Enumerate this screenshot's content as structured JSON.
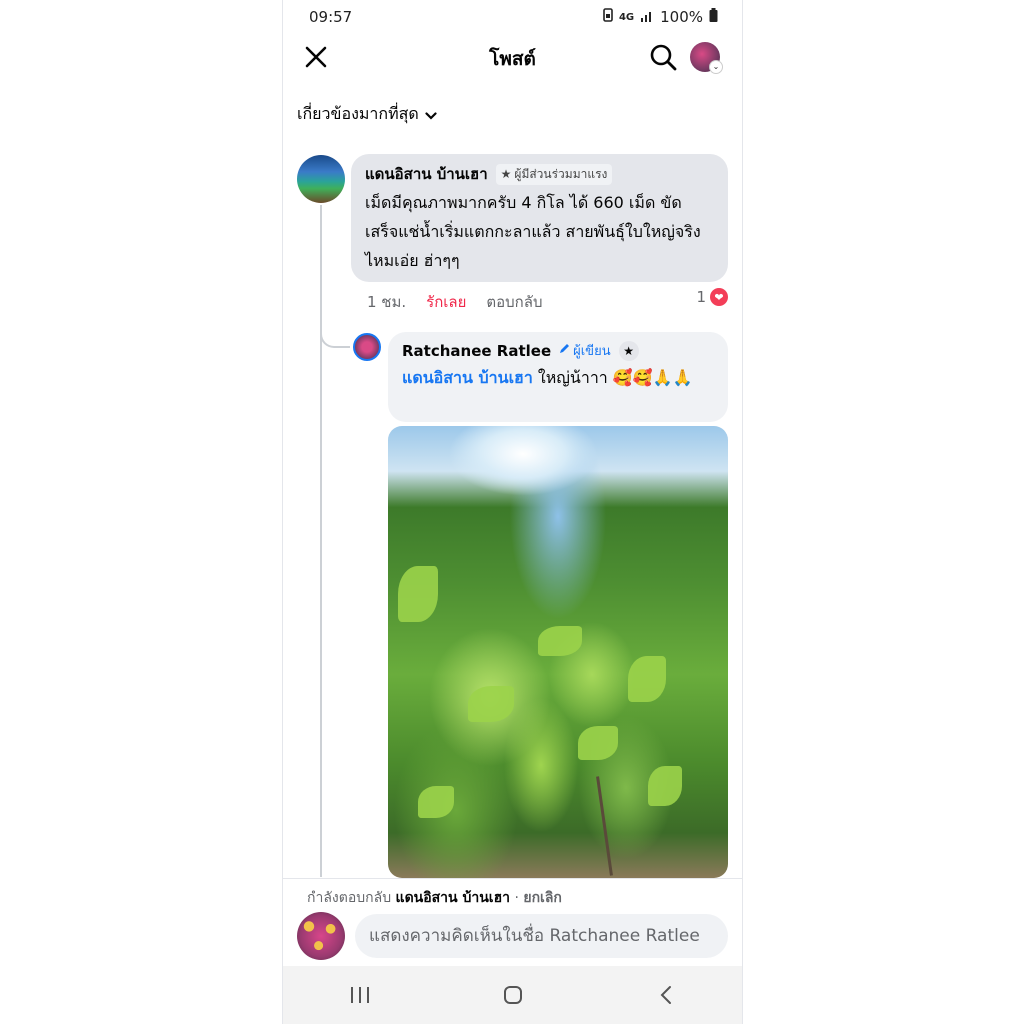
{
  "status_bar": {
    "time": "09:57",
    "network": "4G",
    "battery": "100%"
  },
  "header": {
    "title": "โพสต์"
  },
  "sort": {
    "label": "เกี่ยวข้องมากที่สุด"
  },
  "comments": [
    {
      "author": "แดนอิสาน บ้านเฮา",
      "badge": "ผู้มีส่วนร่วมมาแรง",
      "text": "เม็ดมีคุณภาพมากครับ 4 กิโล ได้ 660 เม็ด ขัดเสร็จแช่น้ำเริ่มแตกกะลาแล้ว สายพันธุ์ใบใหญ่จริงไหมเอ่ย ฮ่าๆๆ",
      "time": "1 ชม.",
      "love_label": "รักเลย",
      "reply_label": "ตอบกลับ",
      "reaction_count": "1"
    }
  ],
  "reply": {
    "author": "Ratchanee Ratlee",
    "author_badge": "ผู้เขียน",
    "mention": "แดนอิสาน บ้านเฮา",
    "text": " ใหญ่น้าาา 🥰🥰🙏🙏"
  },
  "composer": {
    "replying_prefix": "กำลังตอบกลับ",
    "replying_to": "แดนอิสาน บ้านเฮา",
    "separator": " · ",
    "cancel_label": "ยกเลิก",
    "placeholder": "แสดงความคิดเห็นในชื่อ Ratchanee Ratlee"
  },
  "colors": {
    "accent": "#1877f2",
    "love": "#f0284a",
    "bubble": "#e4e6eb"
  },
  "icons": {
    "close": "close-icon",
    "search": "search-icon",
    "chevron": "chevron-down-icon",
    "heart": "heart-icon",
    "star": "star-icon",
    "pen": "pen-icon"
  }
}
